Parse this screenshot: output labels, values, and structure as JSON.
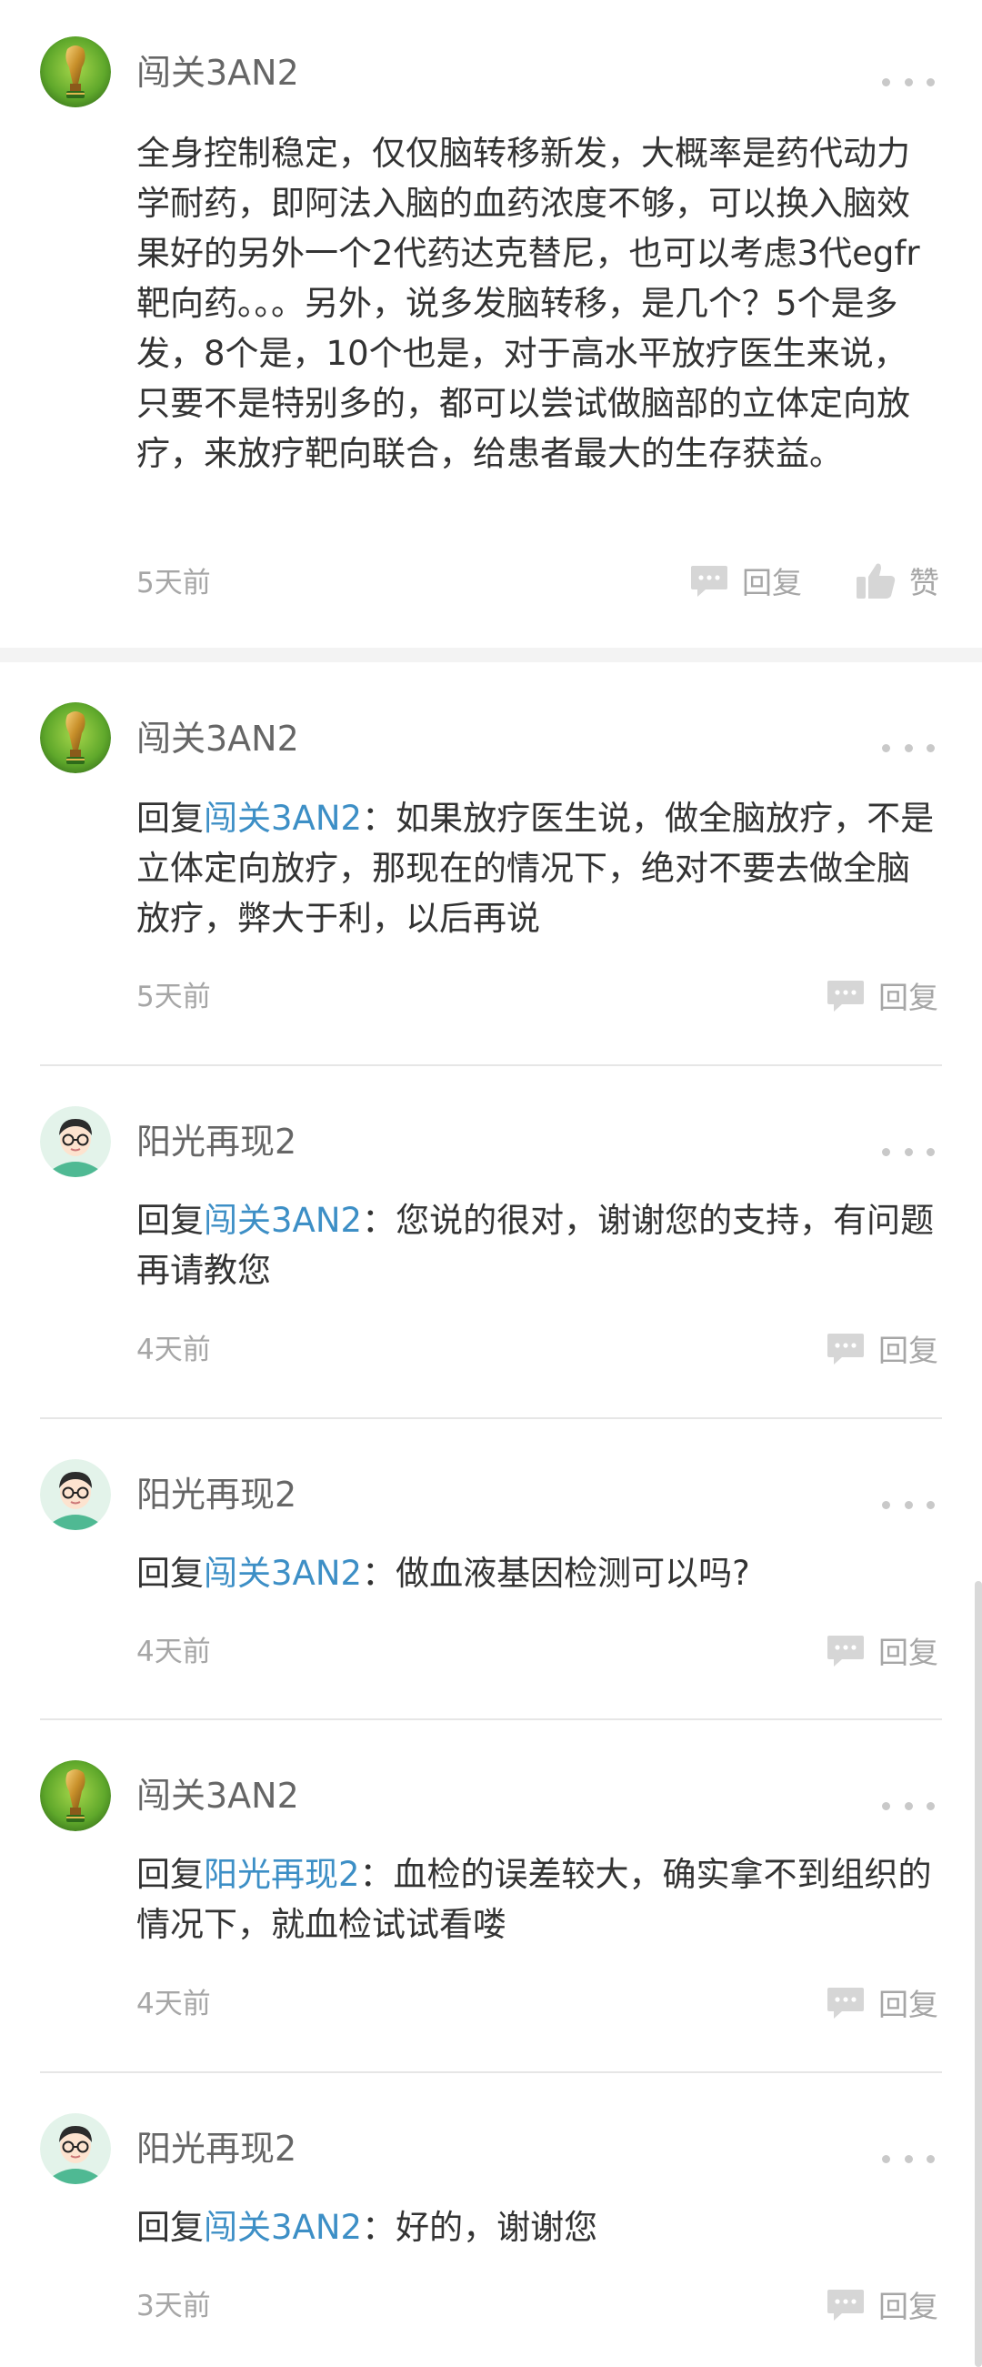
{
  "comments": [
    {
      "username": "闯关3AN2",
      "avatar": "trophy-avatar",
      "text": "全身控制稳定，仅仅脑转移新发，大概率是药代动力学耐药，即阿法入脑的血药浓度不够，可以换入脑效果好的另外一个2代药达克替尼，也可以考虑3代egfr靶向药。。。另外，说多发脑转移，是几个？5个是多发，8个是，10个也是，对于高水平放疗医生来说，只要不是特别多的，都可以尝试做脑部的立体定向放疗，来放疗靶向联合，给患者最大的生存获益。",
      "time": "5天前",
      "reply_label": "回复",
      "like_label": "赞"
    },
    {
      "username": "闯关3AN2",
      "avatar": "trophy-avatar",
      "reply_prefix": "回复",
      "mention": "闯关3AN2",
      "text": "：如果放疗医生说，做全脑放疗，不是立体定向放疗，那现在的情况下，绝对不要去做全脑放疗，弊大于利，以后再说",
      "time": "5天前",
      "reply_label": "回复"
    },
    {
      "username": "阳光再现2",
      "avatar": "glasses-avatar",
      "reply_prefix": "回复",
      "mention": "闯关3AN2",
      "text": "：您说的很对，谢谢您的支持，有问题再请教您",
      "time": "4天前",
      "reply_label": "回复"
    },
    {
      "username": "阳光再现2",
      "avatar": "glasses-avatar",
      "reply_prefix": "回复",
      "mention": "闯关3AN2",
      "text": "：做血液基因检测可以吗?",
      "time": "4天前",
      "reply_label": "回复"
    },
    {
      "username": "闯关3AN2",
      "avatar": "trophy-avatar",
      "reply_prefix": "回复",
      "mention": "阳光再现2",
      "text": "：血检的误差较大，确实拿不到组织的情况下，就血检试试看喽",
      "time": "4天前",
      "reply_label": "回复"
    },
    {
      "username": "阳光再现2",
      "avatar": "glasses-avatar",
      "reply_prefix": "回复",
      "mention": "闯关3AN2",
      "text": "：好的，谢谢您",
      "time": "3天前",
      "reply_label": "回复"
    }
  ],
  "icons": {
    "more": "more-icon",
    "reply": "comment-bubble-icon",
    "like": "thumbs-up-icon"
  },
  "colors": {
    "mention": "#3d8fc6",
    "muted": "#a6a6a6",
    "text": "#333333"
  }
}
